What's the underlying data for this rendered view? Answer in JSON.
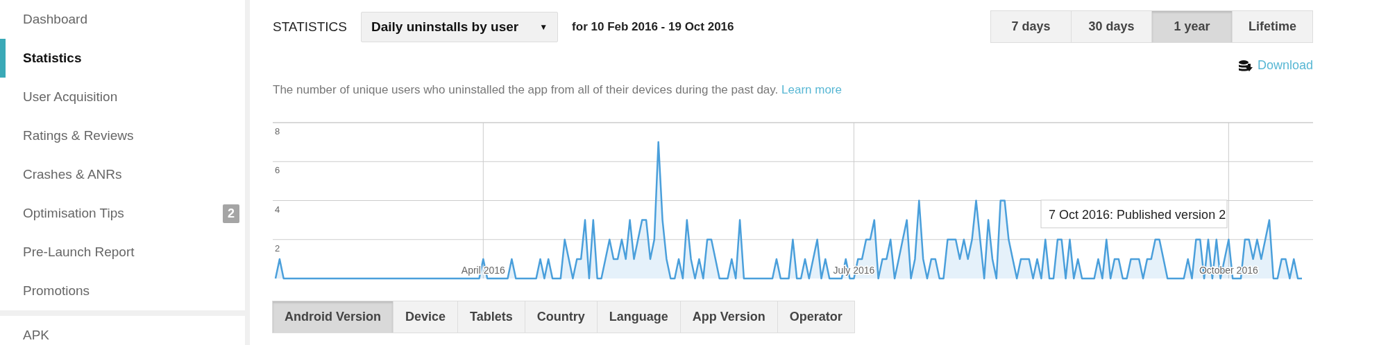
{
  "sidebar": {
    "items": [
      {
        "label": "Dashboard",
        "selected": false
      },
      {
        "label": "Statistics",
        "selected": true
      },
      {
        "label": "User Acquisition",
        "selected": false
      },
      {
        "label": "Ratings & Reviews",
        "selected": false
      },
      {
        "label": "Crashes & ANRs",
        "selected": false
      },
      {
        "label": "Optimisation Tips",
        "selected": false,
        "badge": "2"
      },
      {
        "label": "Pre-Launch Report",
        "selected": false
      },
      {
        "label": "Promotions",
        "selected": false
      }
    ],
    "section_items": [
      {
        "label": "APK",
        "selected": false
      }
    ]
  },
  "header": {
    "title": "STATISTICS",
    "metric_dropdown": {
      "value": "Daily uninstalls by user",
      "caret": "▼"
    },
    "date_range": "for 10 Feb 2016 - 19 Oct 2016",
    "range_buttons": [
      {
        "label": "7 days",
        "selected": false
      },
      {
        "label": "30 days",
        "selected": false
      },
      {
        "label": "1 year",
        "selected": true
      },
      {
        "label": "Lifetime",
        "selected": false
      }
    ]
  },
  "download": {
    "label": "Download"
  },
  "description": {
    "text": "The number of unique users who uninstalled the app from all of their devices during the past day.",
    "link": "Learn more"
  },
  "chart": {
    "chart_data": {
      "type": "line",
      "grid": true,
      "ylim": [
        0,
        8
      ],
      "yticks": [
        2,
        4,
        6,
        8
      ],
      "categories": [
        null,
        null,
        null,
        null,
        null,
        null,
        null,
        null,
        null,
        null,
        null,
        null,
        null,
        null,
        null,
        null,
        null,
        null,
        null,
        null,
        null,
        null,
        null,
        null,
        null,
        null,
        null,
        null,
        null,
        null,
        null,
        null,
        null,
        null,
        null,
        null,
        null,
        null,
        null,
        null,
        null,
        null,
        null,
        null,
        null,
        null,
        null,
        null,
        null,
        null,
        null,
        "April 2016",
        null,
        null,
        null,
        null,
        null,
        null,
        null,
        null,
        null,
        null,
        null,
        null,
        null,
        null,
        null,
        null,
        null,
        null,
        null,
        null,
        null,
        null,
        null,
        null,
        null,
        null,
        null,
        null,
        null,
        null,
        null,
        null,
        null,
        null,
        null,
        null,
        null,
        null,
        null,
        null,
        null,
        null,
        null,
        null,
        null,
        null,
        null,
        null,
        null,
        null,
        null,
        null,
        null,
        null,
        null,
        null,
        null,
        null,
        null,
        null,
        null,
        null,
        null,
        null,
        null,
        null,
        null,
        null,
        null,
        null,
        null,
        null,
        null,
        null,
        null,
        null,
        null,
        null,
        null,
        null,
        null,
        null,
        null,
        null,
        null,
        null,
        null,
        null,
        null,
        null,
        "July 2016",
        null,
        null,
        null,
        null,
        null,
        null,
        null,
        null,
        null,
        null,
        null,
        null,
        null,
        null,
        null,
        null,
        null,
        null,
        null,
        null,
        null,
        null,
        null,
        null,
        null,
        null,
        null,
        null,
        null,
        null,
        null,
        null,
        null,
        null,
        null,
        null,
        null,
        null,
        null,
        null,
        null,
        null,
        null,
        null,
        null,
        null,
        null,
        null,
        null,
        null,
        null,
        null,
        null,
        null,
        null,
        null,
        null,
        null,
        null,
        null,
        null,
        null,
        null,
        null,
        null,
        null,
        null,
        null,
        null,
        null,
        null,
        null,
        null,
        null,
        null,
        null,
        null,
        null,
        null,
        null,
        null,
        null,
        null,
        null,
        null,
        null,
        null,
        null,
        null,
        null,
        null,
        "October 2016",
        null,
        null,
        null,
        null,
        null,
        null,
        null,
        null,
        null,
        null,
        null,
        null,
        null,
        null,
        null,
        null,
        null,
        null
      ],
      "series": [
        {
          "color": "#4a9fdb",
          "values": [
            0,
            1,
            0,
            0,
            0,
            0,
            0,
            0,
            0,
            0,
            0,
            0,
            0,
            0,
            0,
            0,
            0,
            0,
            0,
            0,
            0,
            0,
            0,
            0,
            0,
            0,
            0,
            0,
            0,
            0,
            0,
            0,
            0,
            0,
            0,
            0,
            0,
            0,
            0,
            0,
            0,
            0,
            0,
            0,
            0,
            0,
            0,
            0,
            0,
            0,
            0,
            1,
            0,
            0,
            0,
            0,
            0,
            0,
            1,
            0,
            0,
            0,
            0,
            0,
            0,
            1,
            0,
            1,
            0,
            0,
            0,
            2,
            1,
            0,
            1,
            1,
            3,
            0,
            3,
            0,
            0,
            1,
            2,
            1,
            1,
            2,
            1,
            3,
            1,
            2,
            3,
            3,
            1,
            2,
            7,
            3,
            1,
            0,
            0,
            1,
            0,
            3,
            1,
            0,
            1,
            0,
            2,
            2,
            1,
            0,
            0,
            0,
            1,
            0,
            3,
            0,
            0,
            0,
            0,
            0,
            0,
            0,
            0,
            1,
            0,
            0,
            0,
            2,
            0,
            0,
            1,
            0,
            1,
            2,
            0,
            1,
            0,
            0,
            0,
            0,
            1,
            0,
            0,
            1,
            1,
            2,
            2,
            3,
            0,
            1,
            1,
            2,
            0,
            1,
            2,
            3,
            0,
            1,
            4,
            1,
            0,
            1,
            1,
            0,
            0,
            2,
            2,
            2,
            1,
            2,
            1,
            2,
            4,
            2,
            0,
            3,
            1,
            0,
            4,
            4,
            2,
            1,
            0,
            1,
            1,
            1,
            0,
            1,
            0,
            2,
            0,
            0,
            2,
            2,
            0,
            2,
            0,
            1,
            0,
            0,
            0,
            0,
            1,
            0,
            2,
            0,
            1,
            1,
            0,
            0,
            1,
            1,
            1,
            0,
            1,
            1,
            2,
            2,
            1,
            0,
            0,
            0,
            0,
            0,
            1,
            0,
            2,
            2,
            0,
            2,
            0,
            2,
            0,
            1,
            2,
            0,
            0,
            0,
            2,
            2,
            1,
            2,
            1,
            2,
            3,
            0,
            0,
            1,
            1,
            0,
            1,
            0,
            0
          ]
        }
      ],
      "annotations": [
        "7 Oct 2016: Published version 2"
      ]
    }
  },
  "dimension_tabs": [
    {
      "label": "Android Version",
      "selected": true
    },
    {
      "label": "Device",
      "selected": false
    },
    {
      "label": "Tablets",
      "selected": false
    },
    {
      "label": "Country",
      "selected": false
    },
    {
      "label": "Language",
      "selected": false
    },
    {
      "label": "App Version",
      "selected": false
    },
    {
      "label": "Operator",
      "selected": false
    }
  ]
}
